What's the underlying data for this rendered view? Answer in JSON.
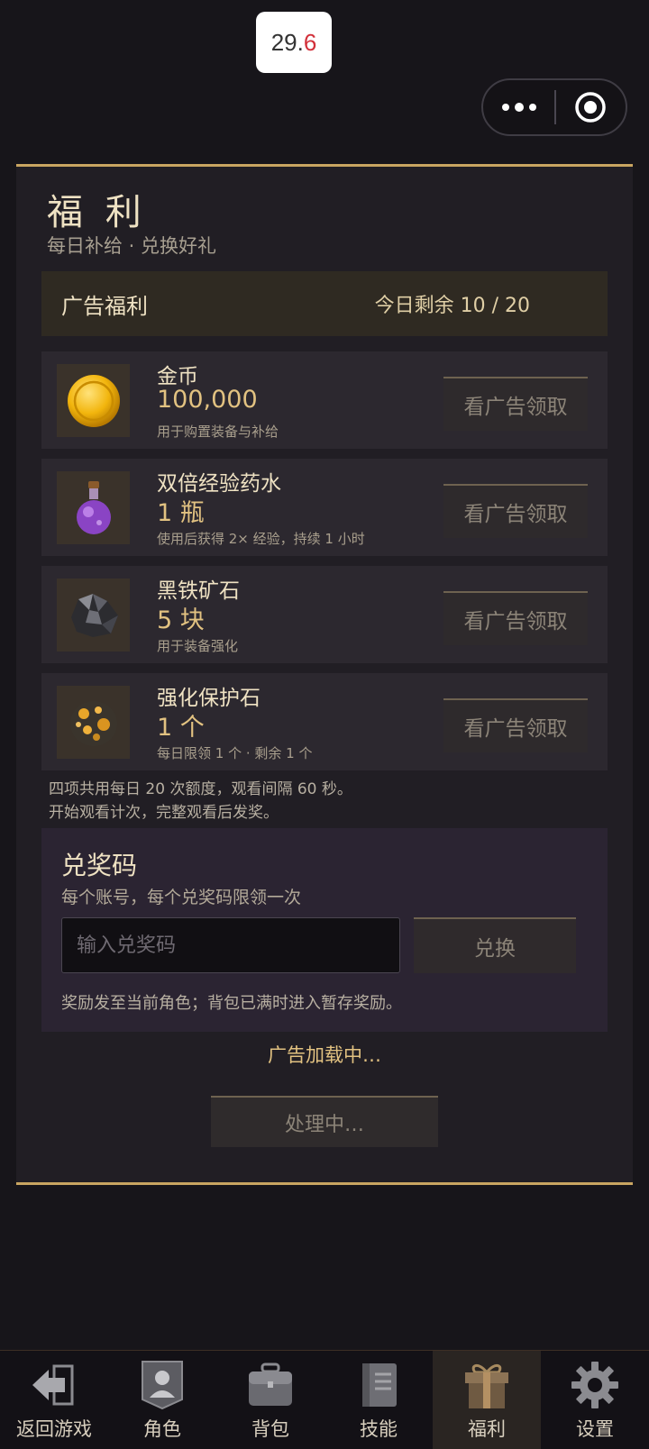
{
  "status": {
    "fps_int": "29.",
    "fps_dec": "6"
  },
  "capsule": {
    "more_icon": "more-dots-icon",
    "close_icon": "target-circle-icon"
  },
  "welfare": {
    "title": "福 利",
    "subtitle": "每日补给 · 兑换好礼",
    "ad_section": {
      "label": "广告福利",
      "remaining": "今日剩余  10 / 20"
    },
    "rewards": [
      {
        "name": "金币",
        "amount": "100,000",
        "desc": "用于购置装备与补给",
        "button": "看广告领取",
        "icon": "gold-coin-icon"
      },
      {
        "name": "双倍经验药水",
        "amount": "1 瓶",
        "desc": "使用后获得 2× 经验，持续 1 小时",
        "button": "看广告领取",
        "icon": "potion-icon"
      },
      {
        "name": "黑铁矿石",
        "amount": "5 块",
        "desc": "用于装备强化",
        "button": "看广告领取",
        "icon": "iron-ore-icon"
      },
      {
        "name": "强化保护石",
        "amount": "1 个",
        "desc": "每日限领 1 个 · 剩余 1 个",
        "button": "看广告领取",
        "icon": "protection-stone-icon"
      }
    ],
    "notes": [
      "四项共用每日 20 次额度，观看间隔 60 秒。",
      "开始观看计次，完整观看后发奖。"
    ],
    "redeem": {
      "title": "兑奖码",
      "subtitle": "每个账号，每个兑奖码限领一次",
      "placeholder": "输入兑奖码",
      "button": "兑换",
      "note": "奖励发至当前角色；背包已满时进入暂存奖励。"
    },
    "ad_loading": "广告加载中…",
    "processing": "处理中…"
  },
  "nav": [
    {
      "label": "返回游戏",
      "icon": "back-arrow-icon"
    },
    {
      "label": "角色",
      "icon": "character-icon"
    },
    {
      "label": "背包",
      "icon": "backpack-icon"
    },
    {
      "label": "技能",
      "icon": "skill-book-icon"
    },
    {
      "label": "福利",
      "icon": "gift-icon",
      "active": true
    },
    {
      "label": "设置",
      "icon": "gear-icon"
    }
  ],
  "colors": {
    "accent": "#c9a561",
    "gold_text": "#e2c281",
    "background": "#17151a"
  }
}
